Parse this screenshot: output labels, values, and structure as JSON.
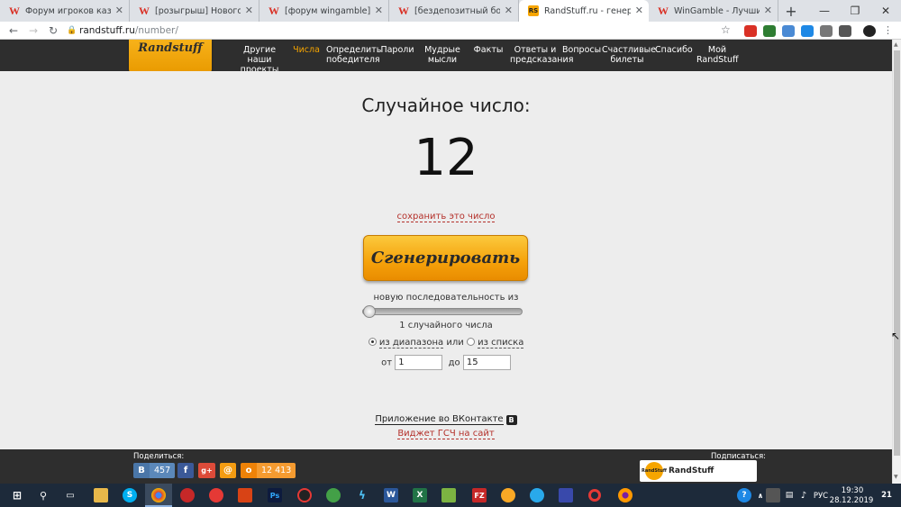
{
  "browser": {
    "tabs": [
      {
        "title": "Форум игроков казино - Wi",
        "favicon": "W",
        "active": false
      },
      {
        "title": "[розыгрыш] Новогоднее Ко",
        "favicon": "W",
        "active": false
      },
      {
        "title": "[форум wingamble] Наши ф",
        "favicon": "W",
        "active": false
      },
      {
        "title": "[бездепозитный бонус] Фри",
        "favicon": "W",
        "active": false
      },
      {
        "title": "RandStuff.ru - генератор сл",
        "favicon": "RS",
        "active": true
      },
      {
        "title": "WinGamble - Лучшие казин",
        "favicon": "W",
        "active": false
      }
    ],
    "new_tab": "+",
    "url_host": "randstuff.ru",
    "url_path": "/number/"
  },
  "site": {
    "logo_text": "Randstuff",
    "nav": [
      {
        "label": "Другие наши проекты",
        "active": false
      },
      {
        "label": "Числа",
        "active": true
      },
      {
        "label": "Определить победителя",
        "active": false
      },
      {
        "label": "Пароли",
        "active": false
      },
      {
        "label": "Мудрые мысли",
        "active": false
      },
      {
        "label": "Факты",
        "active": false
      },
      {
        "label": "Ответы и предсказания",
        "active": false
      },
      {
        "label": "Вопросы",
        "active": false
      },
      {
        "label": "Счастливые билеты",
        "active": false
      },
      {
        "label": "Спасибо",
        "active": false
      },
      {
        "label": "Мой RandStuff",
        "active": false
      }
    ]
  },
  "main": {
    "title": "Случайное число:",
    "number": "12",
    "save_link": "сохранить это число",
    "generate_button": "Сгенерировать",
    "sequence_label": "новую последовательность из",
    "slider_value": 1,
    "count_label": "1 случайного числа",
    "mode_range": "из диапазона",
    "mode_or": "или",
    "mode_list": "из списка",
    "from_label": "от",
    "from_value": "1",
    "to_label": "до",
    "to_value": "15",
    "vk_app_link": "Приложение во ВКонтакте",
    "vk_badge": "B",
    "widget_link": "Виджет ГСЧ на сайт"
  },
  "footer": {
    "share_label": "Поделиться:",
    "subscribe_label": "Подписаться:",
    "vk_count": "457",
    "ok_count": "12 413",
    "widget_name": "RandStuff",
    "widget_avatar_text": "RandStuff"
  },
  "taskbar": {
    "language": "РУС",
    "time": "19:30",
    "date": "28.12.2019",
    "notifications": "21"
  },
  "colors": {
    "accent": "#f6a500",
    "header_bg": "#2e2e2e",
    "link_red": "#b4302a",
    "taskbar_bg": "#1d2a3a"
  }
}
